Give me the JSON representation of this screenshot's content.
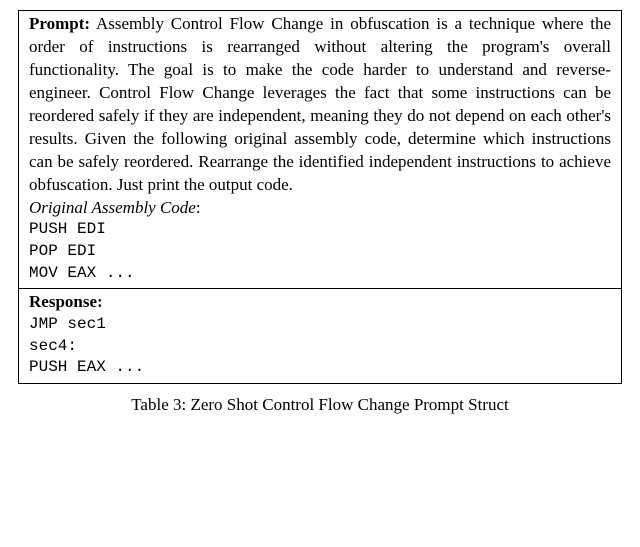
{
  "prompt": {
    "label": "Prompt:",
    "text": " Assembly Control Flow Change in obfuscation is a technique where the order of instructions is rearranged without altering the program's overall functionality. The goal is to make the code harder to understand and reverse-engineer. Control Flow Change leverages the fact that some instructions can be reordered safely if they are independent, meaning they do not depend on each other's results. Given the following original assembly code, determine which instructions can be safely reordered. Rearrange the identified independent instructions to achieve obfuscation. Just print the output code."
  },
  "original": {
    "label": "Original Assembly Code",
    "colon": ":",
    "code": "PUSH EDI\nPOP EDI\nMOV EAX ..."
  },
  "response": {
    "label": "Response:",
    "code": "JMP sec1\nsec4:\nPUSH EAX ..."
  },
  "caption": "Table 3: Zero Shot Control Flow Change Prompt Struct"
}
